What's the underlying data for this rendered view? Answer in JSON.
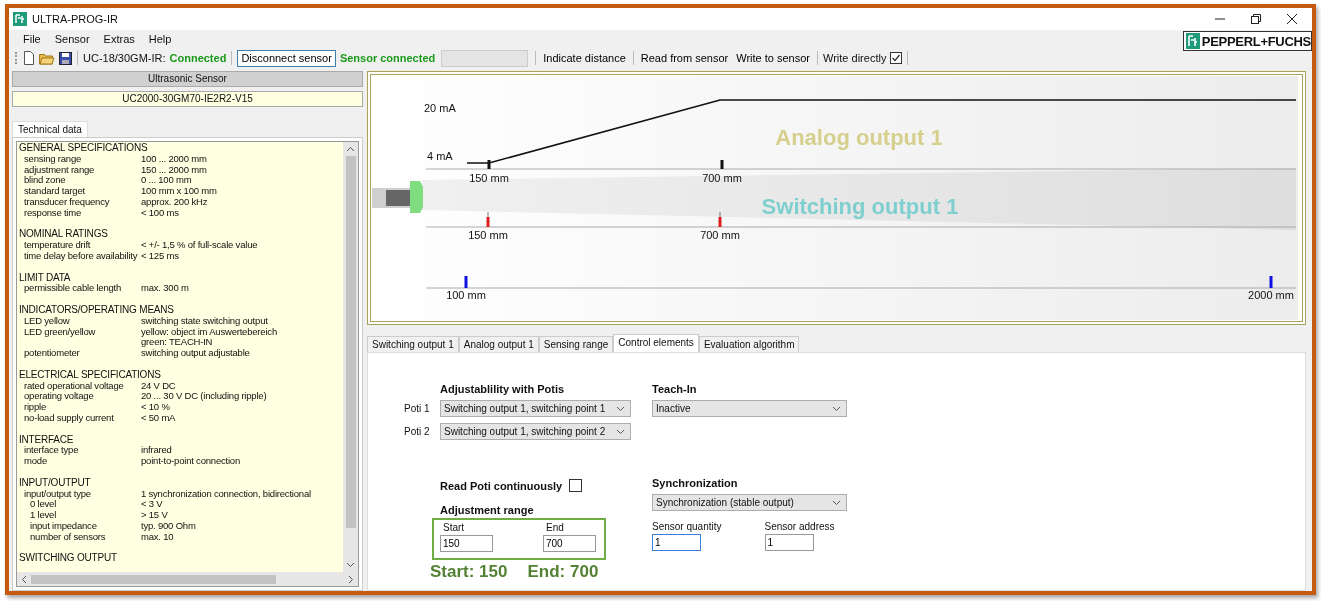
{
  "window": {
    "title": "ULTRA-PROG-IR"
  },
  "menu": [
    "File",
    "Sensor",
    "Extras",
    "Help"
  ],
  "logo": {
    "text": "PEPPERL+FUCHS"
  },
  "toolbar": {
    "device_label": "UC-18/30GM-IR:",
    "device_status": "Connected",
    "disconnect_button": "Disconnect sensor",
    "sensor_status": "Sensor connected",
    "actions": [
      "Indicate distance",
      "Read from sensor",
      "Write to sensor"
    ],
    "write_directly": {
      "label": "Write directly",
      "checked": true
    }
  },
  "sensor_panel": {
    "header": "Ultrasonic Sensor",
    "model": "UC2000-30GM70-IE2R2-V15",
    "tabs": [
      {
        "label": "Technical data",
        "selected": true
      }
    ],
    "sections": [
      {
        "title": "GENERAL SPECIFICATIONS",
        "rows": [
          {
            "kind": "row",
            "label": "sensing range",
            "value": "100 ... 2000 mm"
          },
          {
            "kind": "row",
            "label": "adjustment range",
            "value": "150 ... 2000 mm"
          },
          {
            "kind": "row",
            "label": "blind zone",
            "value": "0 ... 100 mm"
          },
          {
            "kind": "row",
            "label": "standard target",
            "value": "100 mm x 100 mm"
          },
          {
            "kind": "row",
            "label": "transducer frequency",
            "value": "approx. 200 kHz"
          },
          {
            "kind": "row",
            "label": "response time",
            "value": "< 100 ms"
          }
        ]
      },
      {
        "title": "NOMINAL RATINGS",
        "rows": [
          {
            "kind": "row",
            "label": "temperature drift",
            "value": "< +/- 1,5 % of full-scale value"
          },
          {
            "kind": "row",
            "label": "time delay before availability",
            "value": "< 125 ms"
          }
        ]
      },
      {
        "title": "LIMIT DATA",
        "rows": [
          {
            "kind": "row",
            "label": "permissible cable length",
            "value": "max. 300 m"
          }
        ]
      },
      {
        "title": "INDICATORS/OPERATING MEANS",
        "rows": [
          {
            "kind": "row",
            "label": "LED yellow",
            "value": "switching state switching output"
          },
          {
            "kind": "row",
            "label": "LED green/yellow",
            "value": "yellow: object im Auswertebereich"
          },
          {
            "kind": "row",
            "value": "green: TEACH-IN"
          },
          {
            "kind": "row",
            "label": "potentiometer",
            "value": "switching output adjustable"
          }
        ]
      },
      {
        "title": "ELECTRICAL SPECIFICATIONS",
        "rows": [
          {
            "kind": "row",
            "label": "rated operational voltage",
            "value": "24 V DC"
          },
          {
            "kind": "row",
            "label": "operating voltage",
            "value": "20 ... 30 V DC (including ripple)"
          },
          {
            "kind": "row",
            "label": "ripple",
            "value": "< 10 %"
          },
          {
            "kind": "row",
            "label": "no-load supply current",
            "value": "< 50 mA"
          }
        ]
      },
      {
        "title": "INTERFACE",
        "rows": [
          {
            "kind": "row",
            "label": "interface type",
            "value": "infrared"
          },
          {
            "kind": "row",
            "label": "mode",
            "value": "point-to-point connection"
          }
        ]
      },
      {
        "title": "INPUT/OUTPUT",
        "rows": [
          {
            "kind": "row",
            "label": "input/output type",
            "value": "1 synchronization connection, bidirectional"
          },
          {
            "kind": "sub",
            "label": "0 level",
            "value": "< 3 V"
          },
          {
            "kind": "sub",
            "label": "1 level",
            "value": "> 15 V"
          },
          {
            "kind": "sub",
            "label": "input impedance",
            "value": "typ. 900 Ohm"
          },
          {
            "kind": "sub",
            "label": "number of sensors",
            "value": "max. 10"
          }
        ]
      },
      {
        "title": "SWITCHING OUTPUT"
      }
    ]
  },
  "diagram": {
    "analog": {
      "title": "Analog output 1",
      "current_high": "20 mA",
      "current_low": "4 mA",
      "marks": [
        "150 mm",
        "700 mm"
      ]
    },
    "switching": {
      "title": "Switching output 1",
      "marks": [
        "150 mm",
        "700 mm"
      ]
    },
    "range": {
      "marks": [
        "100 mm",
        "2000 mm"
      ]
    }
  },
  "tabs": [
    {
      "label": "Switching output 1",
      "selected": false
    },
    {
      "label": "Analog output 1",
      "selected": false
    },
    {
      "label": "Sensing range",
      "selected": false
    },
    {
      "label": "Control elements",
      "selected": true
    },
    {
      "label": "Evaluation algorithm",
      "selected": false
    }
  ],
  "control_elements": {
    "potis": {
      "heading": "Adjustablility with Potis",
      "rows": [
        {
          "label": "Poti 1",
          "value": "Switching output 1, switching point 1"
        },
        {
          "label": "Poti 2",
          "value": "Switching output 1, switching point 2"
        }
      ]
    },
    "teach_in": {
      "heading": "Teach-In",
      "value": "Inactive"
    },
    "read_poti": {
      "label": "Read Poti continuously",
      "checked": false
    },
    "adjustment_range": {
      "heading": "Adjustment range",
      "fields": [
        {
          "label": "Start",
          "value": "150",
          "focused": false
        },
        {
          "label": "End",
          "value": "700",
          "focused": false
        }
      ]
    },
    "synchronization": {
      "heading": "Synchronization",
      "value": "Synchronization (stable output)",
      "fields": [
        {
          "label": "Sensor quantity",
          "value": "1",
          "focused": true
        },
        {
          "label": "Sensor address",
          "value": "1",
          "focused": false
        }
      ]
    }
  },
  "annotation": [
    "Start: 150",
    "End: 700"
  ]
}
